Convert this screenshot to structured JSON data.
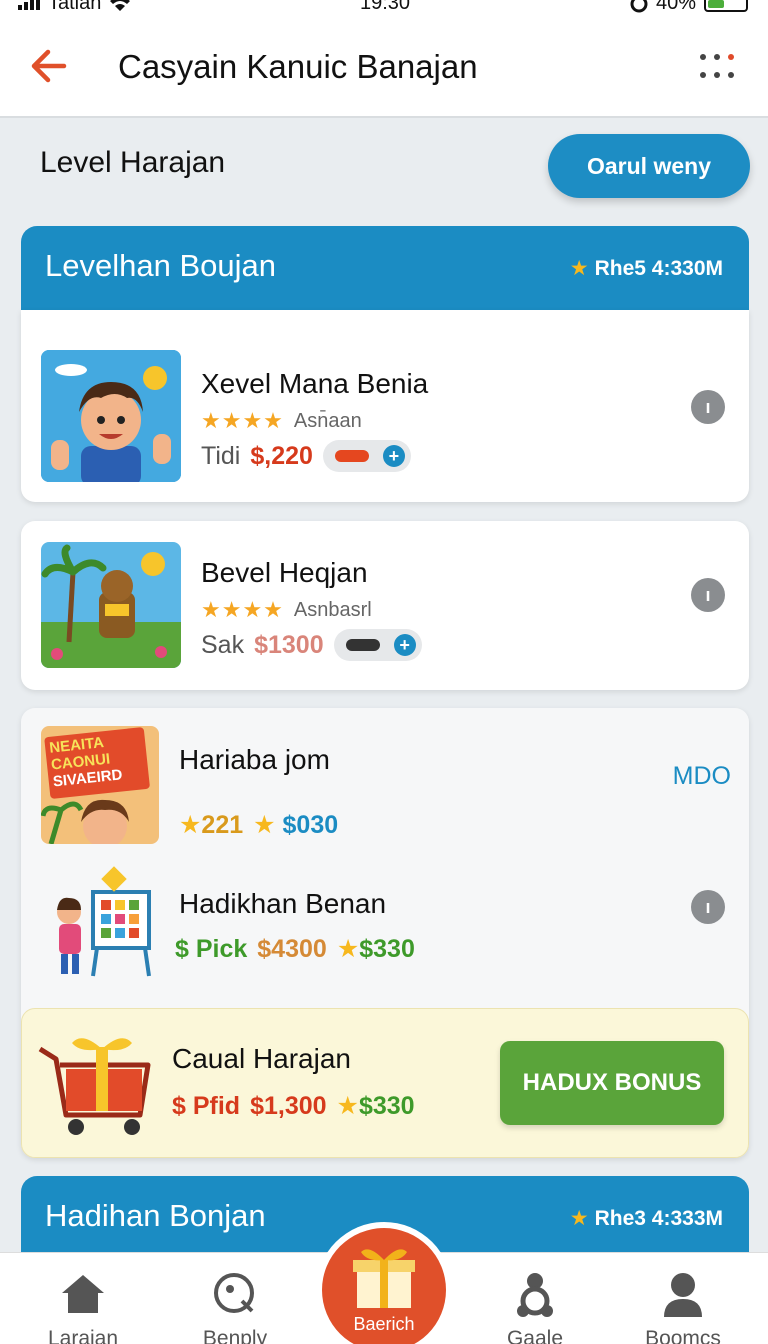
{
  "status_bar": {
    "carrier": "Tatian",
    "time": "19:30",
    "battery": "40%"
  },
  "header": {
    "title": "Casyain Kanuic Banajan"
  },
  "level_heading": {
    "title": "Level Harajan",
    "action_label": "Oarul weny"
  },
  "section1": {
    "title": "Levelhan Boujan",
    "meta": "Rhe5 4:330M"
  },
  "card1": {
    "title": "Xevel Mana Benia",
    "stars": "★★★★",
    "rating_text": "Asn̄aan",
    "price_label": "Tidi",
    "price": "$,220",
    "thumb_icon": "boy-waving-icon"
  },
  "card2": {
    "title": "Bevel Heqjan",
    "stars": "★★★★",
    "rating_text": "Asnbasrl",
    "price_label": "Sak",
    "price": "$1300",
    "thumb_icon": "jungle-character-icon"
  },
  "group": {
    "item1": {
      "title": "Hariaba jom",
      "badge": "MDO",
      "count": "221",
      "price": "$030",
      "thumb_text": [
        "NEAITA",
        "CAONUI",
        "SIVAEIRD"
      ]
    },
    "item2": {
      "title": "Hadikhan Benan",
      "price_label": "$ Pick",
      "price": "$4300",
      "price2": "$330"
    }
  },
  "bonus": {
    "title": "Caual Harajan",
    "price_label": "$ Pfid",
    "price": "$1,300",
    "price2": "$330",
    "button": "HADUX BONUS"
  },
  "section2": {
    "title": "Hadihan Bonjan",
    "meta": "Rhe3 4:333M"
  },
  "nav": {
    "items": [
      {
        "label": "Larajan",
        "icon": "home-icon"
      },
      {
        "label": "Benply",
        "icon": "search-icon"
      },
      {
        "label": "Gaale",
        "icon": "people-icon"
      },
      {
        "label": "Boomcs",
        "icon": "profile-icon"
      }
    ],
    "center_label": "Baerich",
    "center_icon": "gift-icon"
  },
  "colors": {
    "primary": "#1b8cc3",
    "accent": "#e0502a",
    "bonus_green": "#5aa43a"
  }
}
